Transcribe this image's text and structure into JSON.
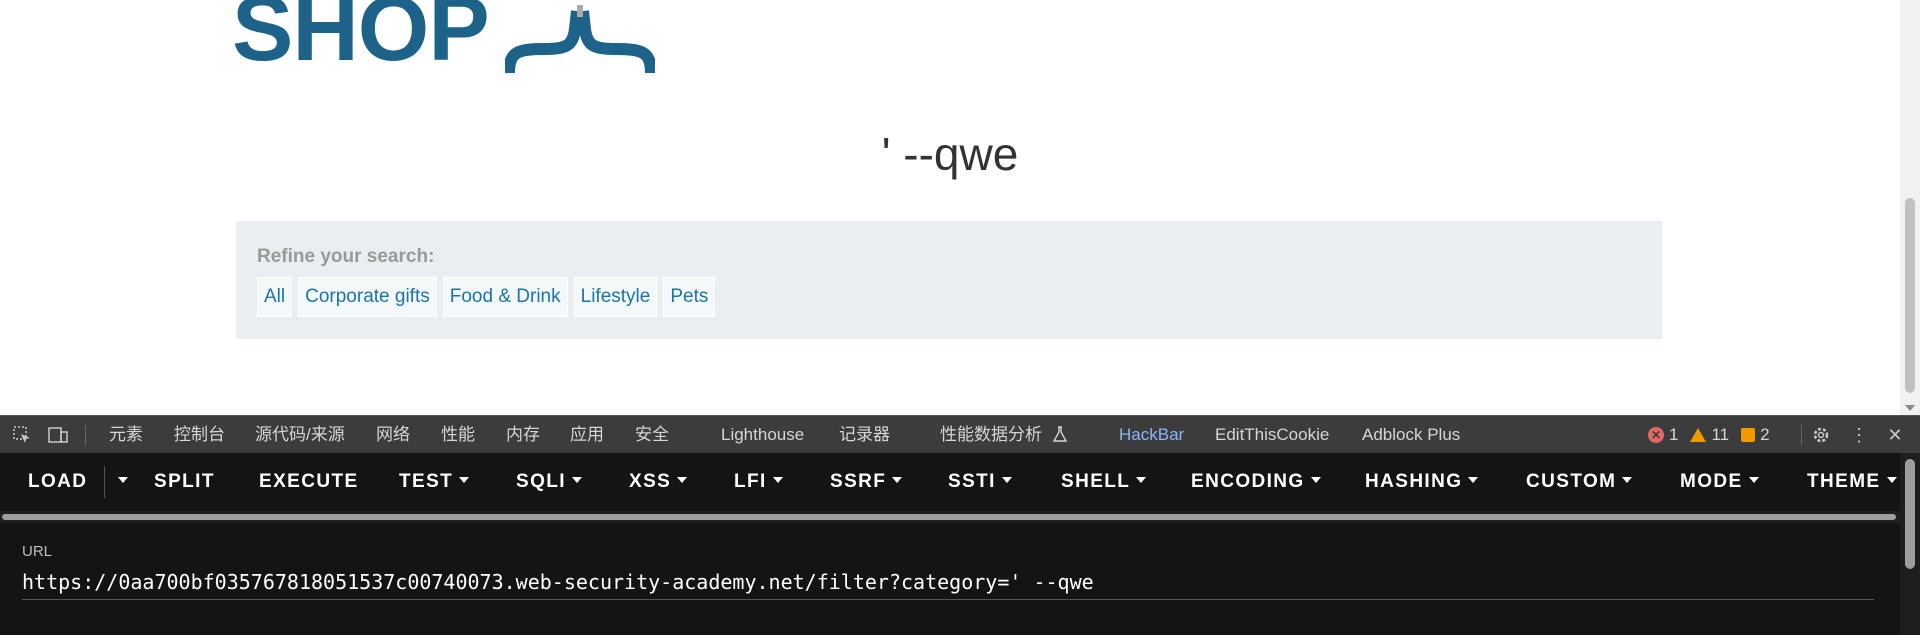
{
  "page": {
    "logo_text": "SHOP",
    "heading": "' --qwe",
    "filter": {
      "label": "Refine your search:",
      "links": [
        "All",
        "Corporate gifts",
        "Food & Drink",
        "Lifestyle",
        "Pets"
      ]
    }
  },
  "devtools": {
    "tabs": [
      "元素",
      "控制台",
      "源代码/来源",
      "网络",
      "性能",
      "内存",
      "应用",
      "安全",
      "Lighthouse",
      "记录器",
      "性能数据分析",
      "HackBar",
      "EditThisCookie",
      "Adblock Plus"
    ],
    "active_tab": "HackBar",
    "counts": {
      "errors": "1",
      "warnings": "11",
      "issues": "2"
    },
    "icons": [
      "inspect-element-icon",
      "device-toolbar-icon",
      "flask-icon",
      "settings-gear-icon",
      "more-options-icon",
      "close-icon"
    ]
  },
  "hackbar": {
    "menu": [
      "LOAD",
      "SPLIT",
      "EXECUTE",
      "TEST",
      "SQLI",
      "XSS",
      "LFI",
      "SSRF",
      "SSTI",
      "SHELL",
      "ENCODING",
      "HASHING",
      "CUSTOM",
      "MODE",
      "THEME"
    ],
    "url_label": "URL",
    "url_value": "https://0aa700bf035767818051537c00740073.web-security-academy.net/filter?category=' --qwe"
  },
  "colors": {
    "logo": "#1d6288",
    "link": "#1a75a9",
    "panel_bg": "#e8eef1",
    "devtools_bar": "#3c3c3c",
    "hackbar_bg": "#141414",
    "active_tab": "#8ab4f8"
  }
}
